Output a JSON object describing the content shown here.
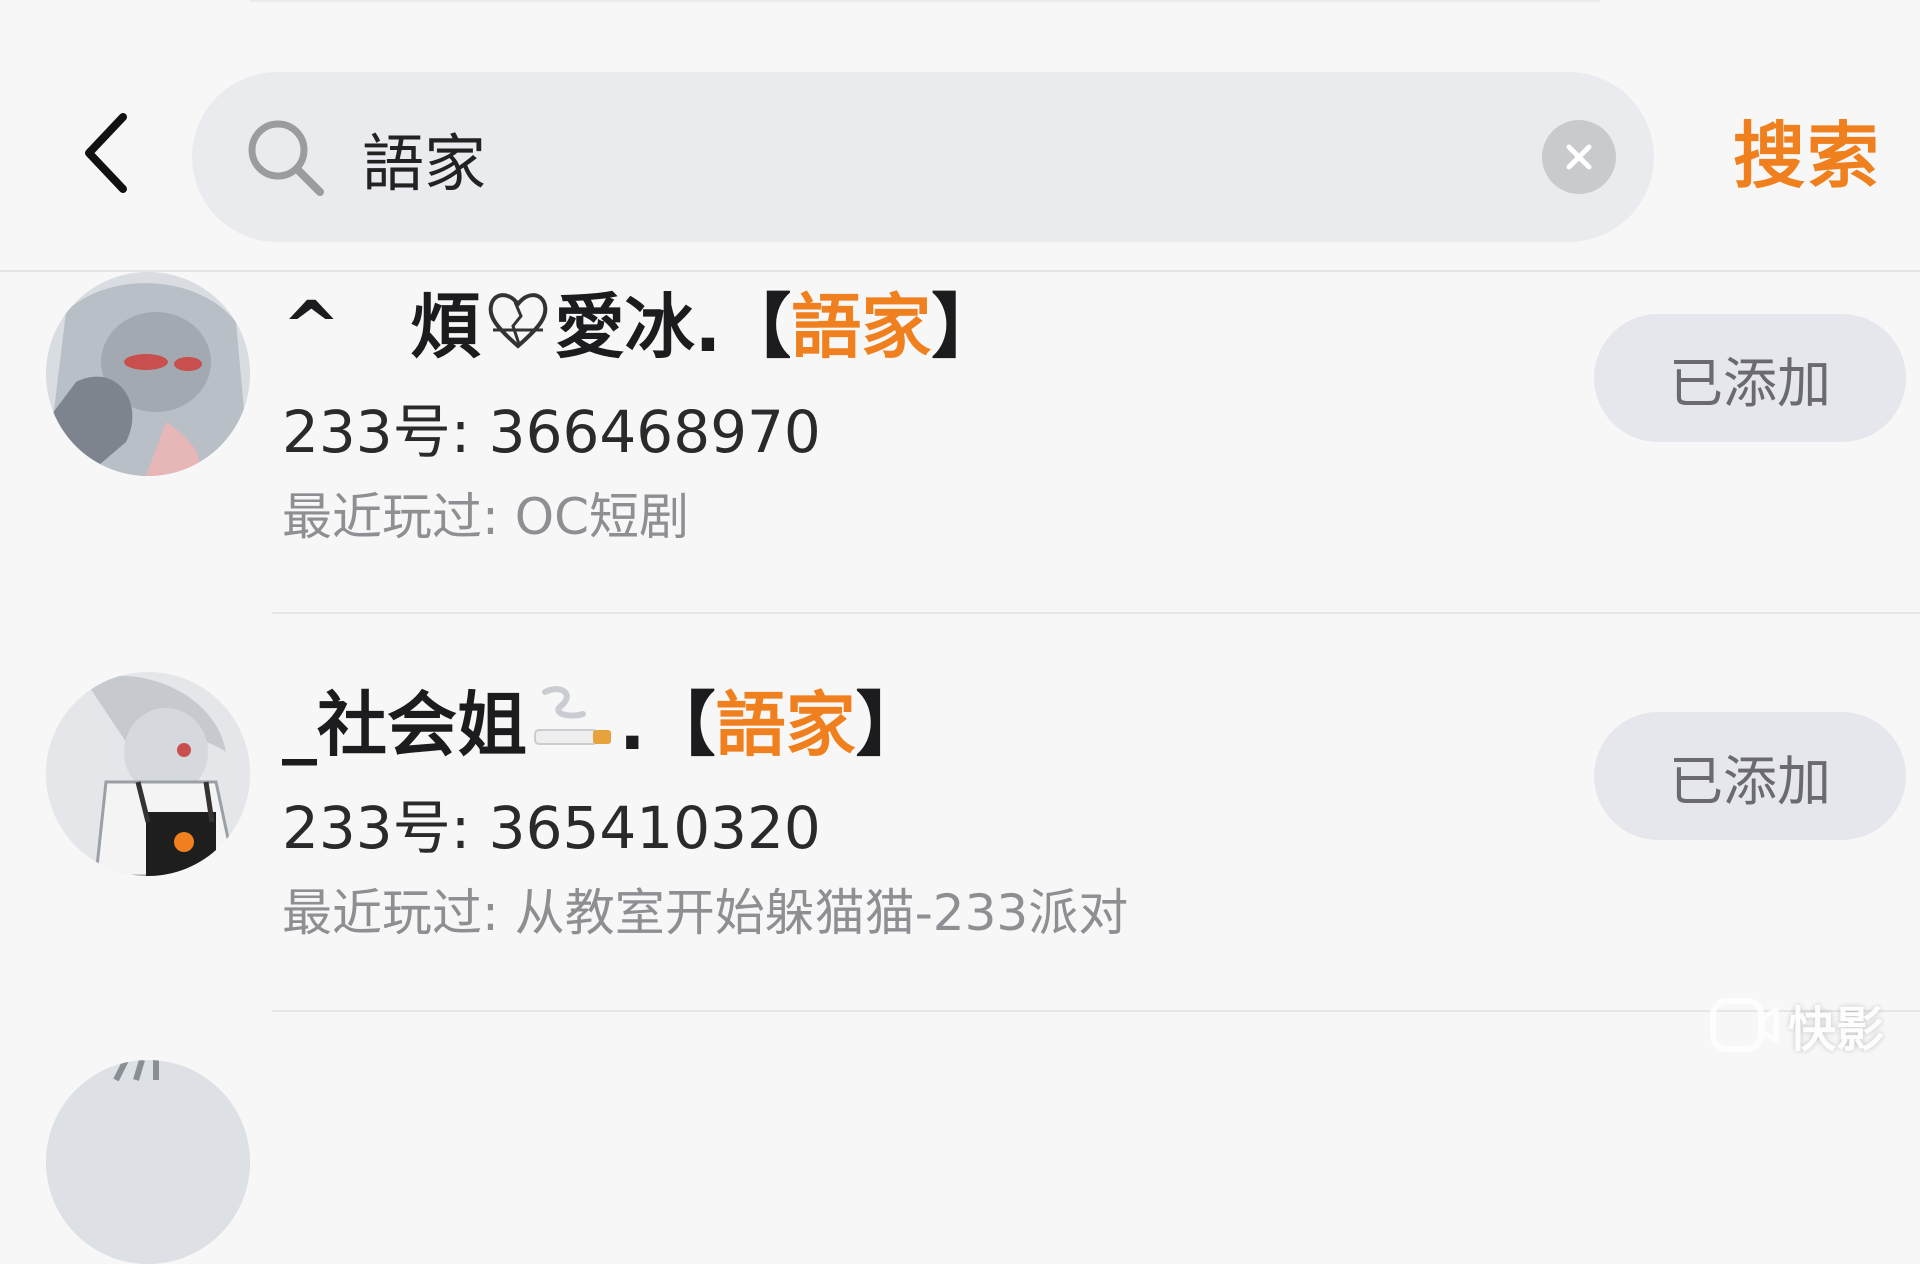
{
  "search": {
    "query": "語家",
    "action_label": "搜索"
  },
  "results": [
    {
      "name_prefix": "^　煩",
      "name_mid": "愛冰.【",
      "name_highlight": "語家",
      "name_suffix": "】",
      "uid": "233号: 366468970",
      "recent": "最近玩过: OC短剧",
      "button_label": "已添加"
    },
    {
      "name_prefix": "_社会姐",
      "name_mid": ".【",
      "name_highlight": "語家",
      "name_suffix": "】",
      "uid": "233号: 365410320",
      "recent": "最近玩过: 从教室开始躲猫猫-233派对",
      "button_label": "已添加"
    }
  ],
  "watermark": {
    "text": "快影"
  },
  "icons": {
    "back": "chevron-left-icon",
    "search": "search-icon",
    "clear": "close-circle-icon",
    "emoji_1": "broken-heart-icon",
    "emoji_2": "cigarette-icon",
    "watermark": "kuaiying-logo-icon"
  },
  "colors": {
    "accent": "#f07f1e",
    "search_bg": "#e9ebee",
    "button_bg": "#e6e7ec",
    "secondary_text": "#8e8e93"
  }
}
